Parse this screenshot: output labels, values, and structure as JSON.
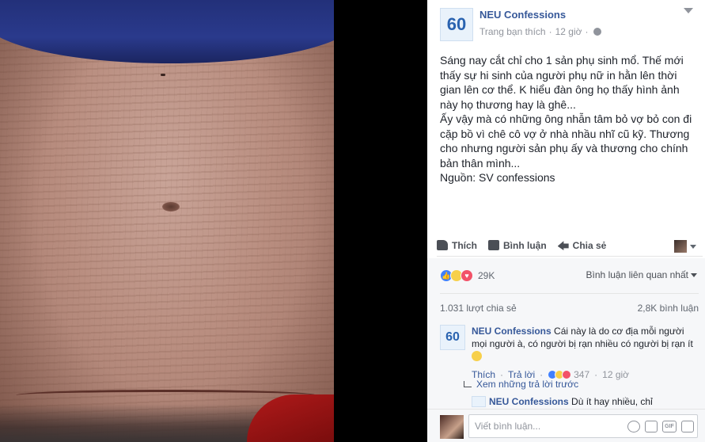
{
  "post": {
    "page_name": "NEU Confessions",
    "avatar_text": "60",
    "meta_audience": "Trang bạn thích",
    "meta_dot": "·",
    "meta_time": "12 giờ",
    "meta_dot2": "·",
    "text": "Sáng nay cắt chỉ cho 1 sản phụ sinh mổ. Thế mới thấy sự hi sinh của người phụ nữ in hằn lên thời gian lên cơ thể. K hiểu đàn ông họ thấy hình ảnh này họ thương hay là ghê...\nẤy vậy mà có những ông nhẫn tâm bỏ vợ bỏ con đi cặp bồ vì chê cô vợ ở nhà nhầu nhĩ cũ kỹ. Thương cho nhưng người sản phụ ấy và thương cho chính bản thân mình...\nNguồn: SV confessions"
  },
  "actions": {
    "like": "Thích",
    "comment": "Bình luận",
    "share": "Chia sẻ"
  },
  "feedback": {
    "reaction_count": "29K",
    "sort_label": "Bình luận liên quan nhất",
    "shares": "1.031 lượt chia sẻ",
    "comments": "2,8K bình luận"
  },
  "comment": {
    "author": "NEU Confessions",
    "text": " Cái này là do cơ địa mỗi người mọi người à, có người bị rạn nhiều có người bị rạn ít ",
    "avatar_text": "60",
    "like": "Thích",
    "dot": "·",
    "reply": "Trả lời",
    "dot2": "·",
    "reaction_count": "347",
    "dot3": "·",
    "time": "12 giờ"
  },
  "replies": {
    "link": "Xem những trả lời trước",
    "author": "NEU Confessions",
    "text": " Dù ít hay nhiều, chỉ"
  },
  "compose": {
    "placeholder": "Viết bình luận..."
  },
  "icons": {
    "gif": "GIF"
  },
  "colors": {
    "link": "#365899",
    "like": "#4080ff",
    "love": "#f25268",
    "sad": "#f7d04b"
  }
}
